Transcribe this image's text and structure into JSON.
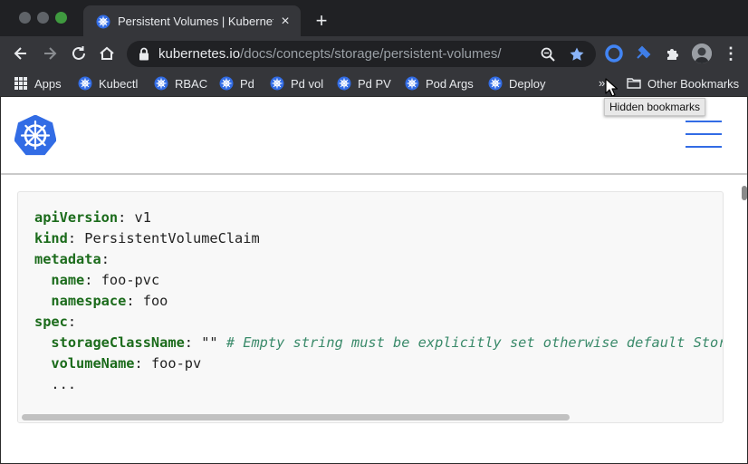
{
  "browser": {
    "tab": {
      "title": "Persistent Volumes | Kubernetes",
      "close_glyph": "×"
    },
    "new_tab_glyph": "+",
    "url": {
      "host": "kubernetes.io",
      "path": "/docs/concepts/storage/persistent-volumes/"
    },
    "bookmarks": [
      {
        "label": "Apps",
        "icon": "apps-grid-icon"
      },
      {
        "label": "Kubectl",
        "icon": "kubernetes-icon"
      },
      {
        "label": "RBAC",
        "icon": "kubernetes-icon"
      },
      {
        "label": "Pd",
        "icon": "kubernetes-icon"
      },
      {
        "label": "Pd vol",
        "icon": "kubernetes-icon"
      },
      {
        "label": "Pd PV",
        "icon": "kubernetes-icon"
      },
      {
        "label": "Pod Args",
        "icon": "kubernetes-icon"
      },
      {
        "label": "Deploy",
        "icon": "kubernetes-icon"
      }
    ],
    "chevron_glyph": "»",
    "other_bookmarks": "Other Bookmarks",
    "tooltip": "Hidden bookmarks",
    "menu_glyph": "⋮"
  },
  "colors": {
    "browser_dark": "#202124",
    "toolbar": "#35363a",
    "kubernetes_blue": "#326ce5",
    "yaml_key": "#1b6b1b",
    "yaml_comment": "#3a8a6a"
  },
  "code": {
    "lines": [
      {
        "indent": "",
        "key": "apiVersion",
        "sep": ": ",
        "value": "v1",
        "comment": ""
      },
      {
        "indent": "",
        "key": "kind",
        "sep": ": ",
        "value": "PersistentVolumeClaim",
        "comment": ""
      },
      {
        "indent": "",
        "key": "metadata",
        "sep": ":",
        "value": "",
        "comment": ""
      },
      {
        "indent": "  ",
        "key": "name",
        "sep": ": ",
        "value": "foo-pvc",
        "comment": ""
      },
      {
        "indent": "  ",
        "key": "namespace",
        "sep": ": ",
        "value": "foo",
        "comment": ""
      },
      {
        "indent": "",
        "key": "spec",
        "sep": ":",
        "value": "",
        "comment": ""
      },
      {
        "indent": "  ",
        "key": "storageClassName",
        "sep": ": ",
        "value": "\"\" ",
        "comment": "# Empty string must be explicitly set otherwise default StorageClass will be set"
      },
      {
        "indent": "  ",
        "key": "volumeName",
        "sep": ": ",
        "value": "foo-pv",
        "comment": ""
      },
      {
        "indent": "  ",
        "key": "",
        "sep": "",
        "value": "...",
        "comment": ""
      }
    ]
  }
}
